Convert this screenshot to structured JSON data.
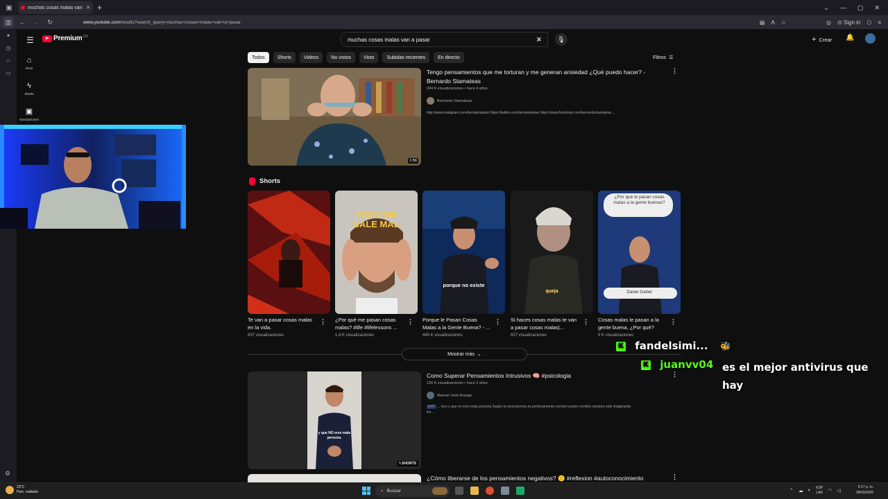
{
  "browser": {
    "tab_title": "muchas cosas malas van a pasa",
    "url_host": "www.youtube.com",
    "url_path": "/results?search_query=muchas+cosas+malas+van+a+pasar",
    "sign_in": "Sign in"
  },
  "youtube": {
    "logo_text": "Premium",
    "logo_country": "CO",
    "search_value": "muchas cosas malas van a pasar",
    "create_label": "Crear",
    "sidebar": [
      {
        "label": "Inicio",
        "icon": "home-icon"
      },
      {
        "label": "Shorts",
        "icon": "shorts-icon"
      },
      {
        "label": "Suscripciones",
        "icon": "subscriptions-icon"
      }
    ],
    "chips": [
      "Todos",
      "Shorts",
      "Videos",
      "No vistos",
      "Visto",
      "Subidas recientes",
      "En directo"
    ],
    "filters_label": "Filtros",
    "results": [
      {
        "title_line1": "Tengo pensamientos que me torturan y me generan ansiedad ¿Qué puedo hacer? -",
        "title_line2": "Bernardo Stamateas",
        "meta": "244 K visualizaciones • hace 4 años",
        "channel": "Bernardo Stamateas",
        "description": "http://www.instagram.com/berstamateas/ https://twitter.com/berstamateas https://www.facebook.com/bernardostamateas ...",
        "duration": "1:56"
      },
      {
        "title": "Como Superar Pensamientos Intrusivos 🧠 #psicologia",
        "meta": "130 K visualizaciones • hace 3 años",
        "channel": "Manuel José Arango",
        "chapter": "0:07",
        "description_line1": "... loco y que no eres mala persona Según la neurociencia es perfectamente normal nuestro cerebro siempre está imaginando",
        "description_line2": "los ...",
        "badge": "SHORTS",
        "thumb_caption": "y que NO eres mala persona."
      },
      {
        "title": "¿Cómo liberarse de los pensamientos negativos? 🙂 #reflexion #autoconocimiento"
      }
    ],
    "shorts_header": "Shorts",
    "shorts": [
      {
        "title": "Te van a pasar cosas malas en la vida.",
        "views": "637 visualizaciones",
        "overlay": ""
      },
      {
        "title": "¿Por qué me pasan cosas malas? #life #lifelessons ...",
        "views": "1,4 K visualizaciones",
        "overlay": "TODO ME SALE MAL"
      },
      {
        "title": "Porque le Pasan Cosas Malas a la Gente Buena? - ...",
        "views": "445 K visualizaciones",
        "overlay": "porque no existe"
      },
      {
        "title": "Si haces cosas malas te van a pasar cosas malas|...",
        "views": "827 visualizaciones",
        "overlay": "queja"
      },
      {
        "title": "Cosas malas le pasan a la gente buena, ¿Por qué?",
        "views": "5 K visualizaciones",
        "overlay": "¿Por qué le pasan cosas malas a la gente buenas?",
        "overlay2": "Dante Gebel"
      }
    ],
    "show_more": "Mostrar más"
  },
  "chat": [
    {
      "user": "fandelsimi...",
      "message": ""
    },
    {
      "user": "juanvv04",
      "message_line1": "es el mejor antivirus que",
      "message_line2": "hay"
    }
  ],
  "taskbar": {
    "weather_temp": "23°C",
    "weather_desc": "Parc. nublado",
    "search_label": "Buscar",
    "lang1": "ESP",
    "lang2": "LAA",
    "time": "9:17 p. m.",
    "date": "28/03/2026"
  }
}
